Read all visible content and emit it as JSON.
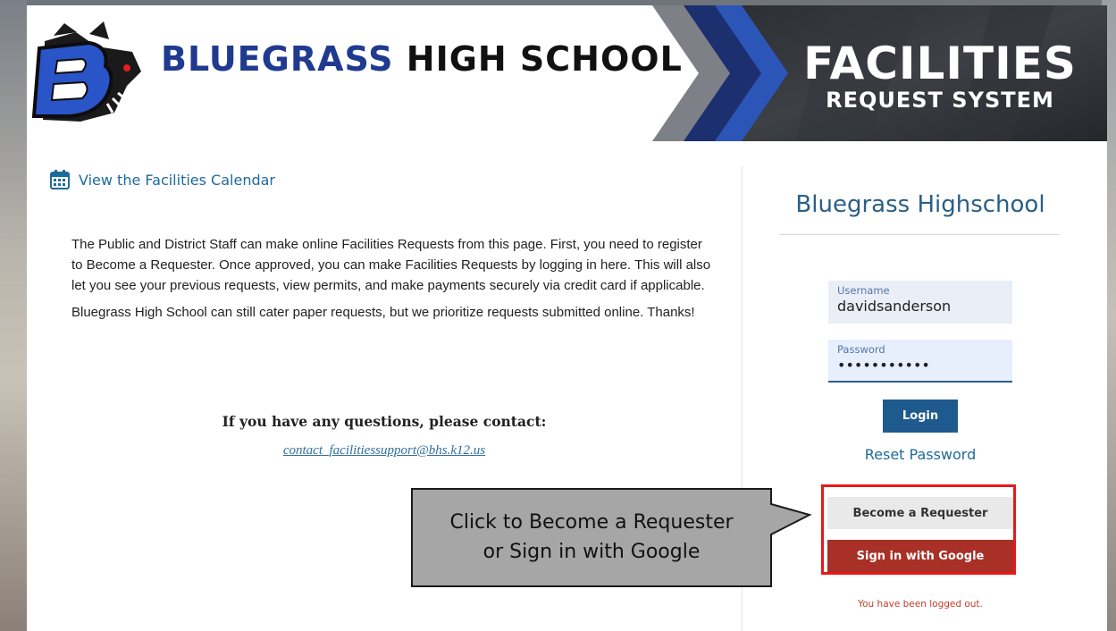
{
  "banner": {
    "school_name_first": "BLUEGRASS",
    "school_name_rest": "HIGH SCHOOL",
    "system_title": "FACILITIES",
    "system_subtitle": "REQUEST SYSTEM",
    "logo_letter": "B"
  },
  "calendar_link": {
    "label": "View the Facilities Calendar",
    "icon": "calendar-icon"
  },
  "intro": {
    "paragraph1": "The Public and District Staff can make online Facilities Requests from this page. First, you need to register to Become a Requester. Once approved, you can make Facilities Requests by logging in here. This will also let you see your previous requests, view permits, and make payments securely via credit card if applicable.",
    "paragraph2": "Bluegrass High School can still cater paper requests, but we prioritize requests submitted online. Thanks!"
  },
  "contact": {
    "heading": "If you have any questions, please contact:",
    "email": "contact_facilitiessupport@bhs.k12.us"
  },
  "login_panel": {
    "title": "Bluegrass Highschool",
    "username_label": "Username",
    "username_value": "davidsanderson",
    "password_label": "Password",
    "password_value": "•••••••••••",
    "login_button": "Login",
    "reset_link": "Reset Password",
    "become_requester_button": "Become a Requester",
    "google_button": "Sign in with Google",
    "status_message": "You have been logged out."
  },
  "callout": {
    "line1": "Click to Become a Requester",
    "line2": "or Sign in with Google"
  },
  "colors": {
    "link_blue": "#1d6b9a",
    "login_button": "#1e5a8e",
    "google_button": "#a83027",
    "highlight_border": "#e81818",
    "status_red": "#c23d2e"
  }
}
